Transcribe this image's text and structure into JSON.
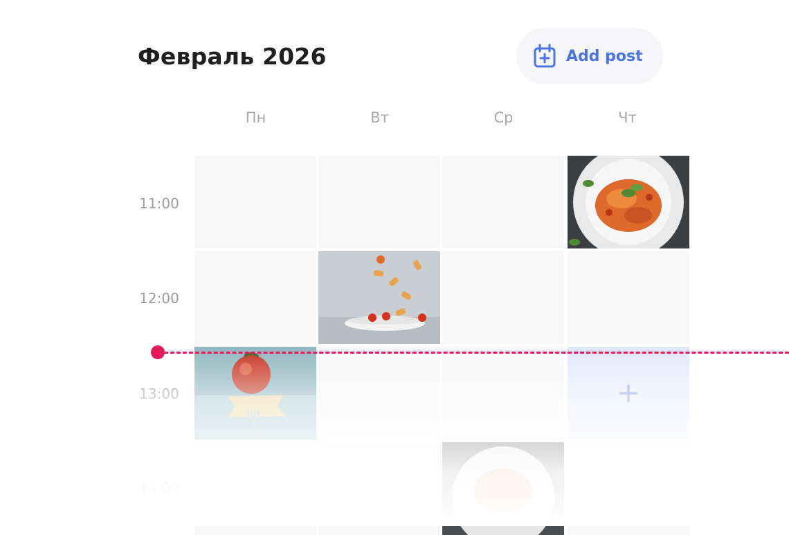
{
  "header": {
    "title": "Февраль 2026",
    "add_button_label": "Add post",
    "add_button_icon": "calendar-plus-icon"
  },
  "days": [
    "Пн",
    "Вт",
    "Ср",
    "Чт"
  ],
  "times": [
    "11:00",
    "12:00",
    "13:00",
    "14:00"
  ],
  "slots": {
    "add_symbol": "+"
  },
  "colors": {
    "accent": "#4a74e6",
    "now_line": "#e5195a",
    "add_slot": "#e0e7fb"
  }
}
